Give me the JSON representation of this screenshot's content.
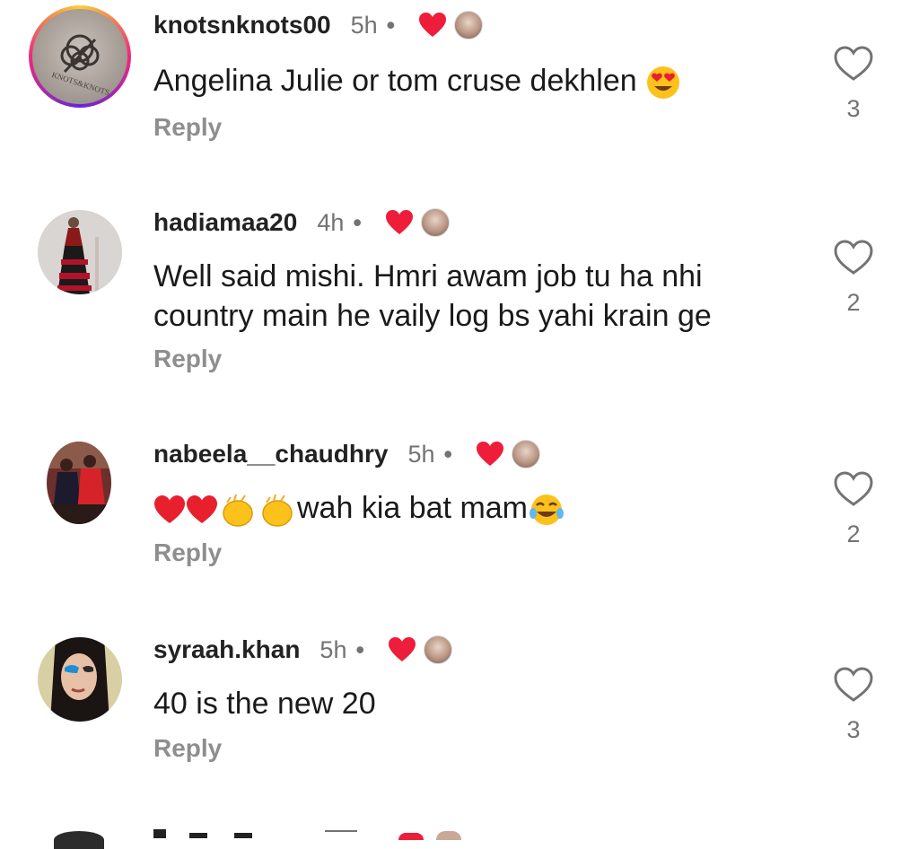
{
  "comments": [
    {
      "username": "knotsnknots00",
      "time": "5h",
      "separator": "•",
      "text": "Angelina Julie or tom cruse dekhlen",
      "text_emoji": "heart-eyes-emoji",
      "reply_label": "Reply",
      "like_count": "3",
      "avatar_logo_text": "KNOTS&KNOTS"
    },
    {
      "username": "hadiamaa20",
      "time": "4h",
      "separator": "•",
      "text_line1": "Well said mishi. Hmri awam job tu ha nhi",
      "text_line2": "country main he vaily log bs yahi krain ge",
      "reply_label": "Reply",
      "like_count": "2"
    },
    {
      "username": "nabeela__chaudhry",
      "time": "5h",
      "separator": "•",
      "text": "wah kia bat mam",
      "text_emoji_prefix": [
        "red-heart-emoji",
        "red-heart-emoji",
        "clapping-hands-emoji",
        "clapping-hands-emoji"
      ],
      "text_emoji_suffix": "tears-of-joy-emoji",
      "reply_label": "Reply",
      "like_count": "2"
    },
    {
      "username": "syraah.khan",
      "time": "5h",
      "separator": "•",
      "text": "40 is the new 20",
      "reply_label": "Reply",
      "like_count": "3"
    }
  ],
  "colors": {
    "heart_red": "#ee1d3a",
    "muted_text": "#737373",
    "reply_gray": "#8e8e8e",
    "story_ring": [
      "#f9ce34",
      "#ee2a7b",
      "#6228d7"
    ]
  }
}
